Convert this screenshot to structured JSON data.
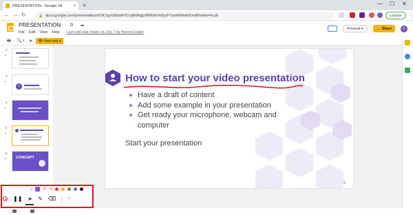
{
  "browser": {
    "tab_title": "PRESENTATION - Google Sli",
    "tab_close": "×",
    "new_tab": "+",
    "window_controls": [
      "—",
      "☐",
      "✕"
    ],
    "url": "docs.google.com/presentation/d/1K7gzGKbqHVCcqfmNqjU4BRdeVoDyrF7umKtMokl2redit#slide=id.p6",
    "update_label": "Update",
    "nav_back": "←",
    "nav_forward": "→",
    "nav_reload": "↻",
    "lock": "🔒",
    "menu_dots": "⋮"
  },
  "docs": {
    "title": "PRESENTATION",
    "title_icons": "☆ ⧉ ☁",
    "menu": [
      "File",
      "Edit",
      "View",
      "Help"
    ],
    "last_edit": "Last edit was made on July 7 by BoreoCreator",
    "present_label": "Present",
    "present_caret": "▾",
    "share_label": "🔒 Share",
    "avatar_letter": "C"
  },
  "toolbar": {
    "print": "🖶",
    "zoom": "🔍",
    "zoom_caret": "▾",
    "pointer": "➤",
    "view_only_label": "👁 View only ▾"
  },
  "filmstrip": {
    "numbers": [
      "2",
      "3",
      "4",
      "5",
      "6"
    ],
    "concept_label": "CONCEPT",
    "thumb_badge": "1"
  },
  "slide": {
    "title": "How to start your video presentation",
    "bullets": [
      "Have a draft of content",
      "Add some example in your presentation",
      "Get ready your microphone, webcam and computer"
    ],
    "plain_text": "Start your presentation",
    "page_number": "5"
  },
  "drawing_toolbar": {
    "tool_icons": [
      "⌂",
      "▤",
      "↶",
      "↷"
    ],
    "pen_colors": [
      "#e53935",
      "#f4b400",
      "#43a047",
      "#1e88e5",
      "#111111"
    ],
    "close": "×",
    "pause": "❚❚",
    "pointer": "➤",
    "pen": "✎",
    "eraser": "⌫"
  },
  "colors": {
    "accent_purple": "#5b3fb0",
    "brand_yellow": "#f4b400",
    "annotation_red": "#d71920"
  }
}
